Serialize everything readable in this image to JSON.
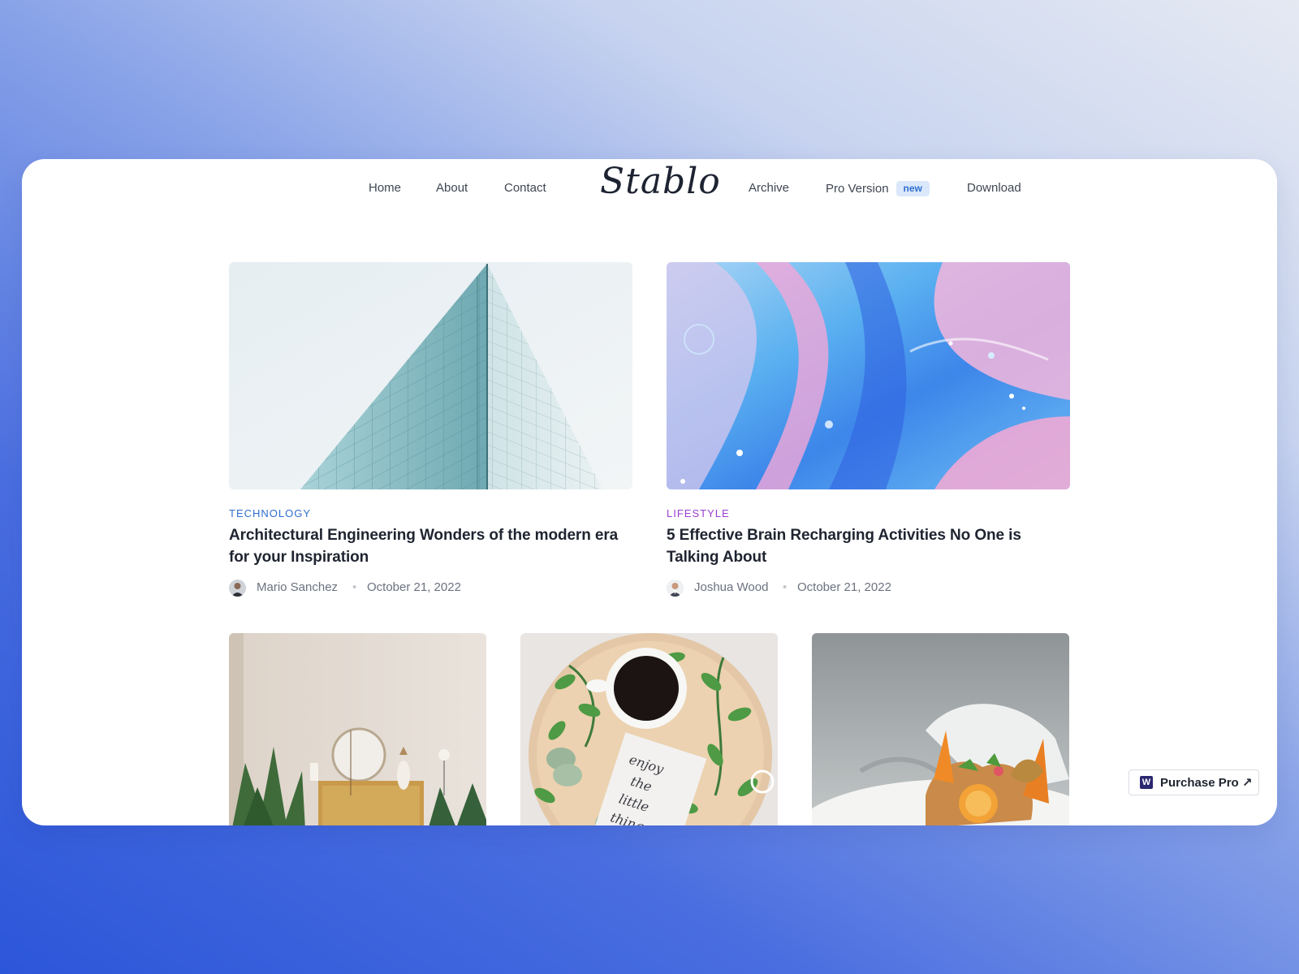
{
  "nav": {
    "left_items": [
      {
        "label": "Home"
      },
      {
        "label": "About"
      },
      {
        "label": "Contact"
      }
    ],
    "logo": "Stablo",
    "right_items": [
      {
        "label": "Archive"
      },
      {
        "label": "Pro Version",
        "badge": "new"
      },
      {
        "label": "Download"
      }
    ]
  },
  "featured_posts": [
    {
      "category": "TECHNOLOGY",
      "category_color": "#2f6fd0",
      "title": "Architectural Engineering Wonders of the modern era for your Inspiration",
      "author": "Mario Sanchez",
      "date": "October 21, 2022",
      "image_icon": "glass-building-image"
    },
    {
      "category": "LIFESTYLE",
      "category_color": "#9b3fd0",
      "title": "5 Effective Brain Recharging Activities No One is Talking About",
      "author": "Joshua Wood",
      "date": "October 21, 2022",
      "image_icon": "fluid-art-image"
    }
  ],
  "grid_posts": [
    {
      "image_icon": "living-room-image"
    },
    {
      "image_icon": "coffee-flatlay-image",
      "image_text": "enjoy the little things"
    },
    {
      "image_icon": "food-plate-image"
    }
  ],
  "purchase_button": {
    "label": "Purchase Pro ↗",
    "logo_letter": "W"
  },
  "colors": {
    "accent": "#2f6fd0",
    "lifestyle": "#9b3fd0",
    "text": "#1f2430"
  }
}
